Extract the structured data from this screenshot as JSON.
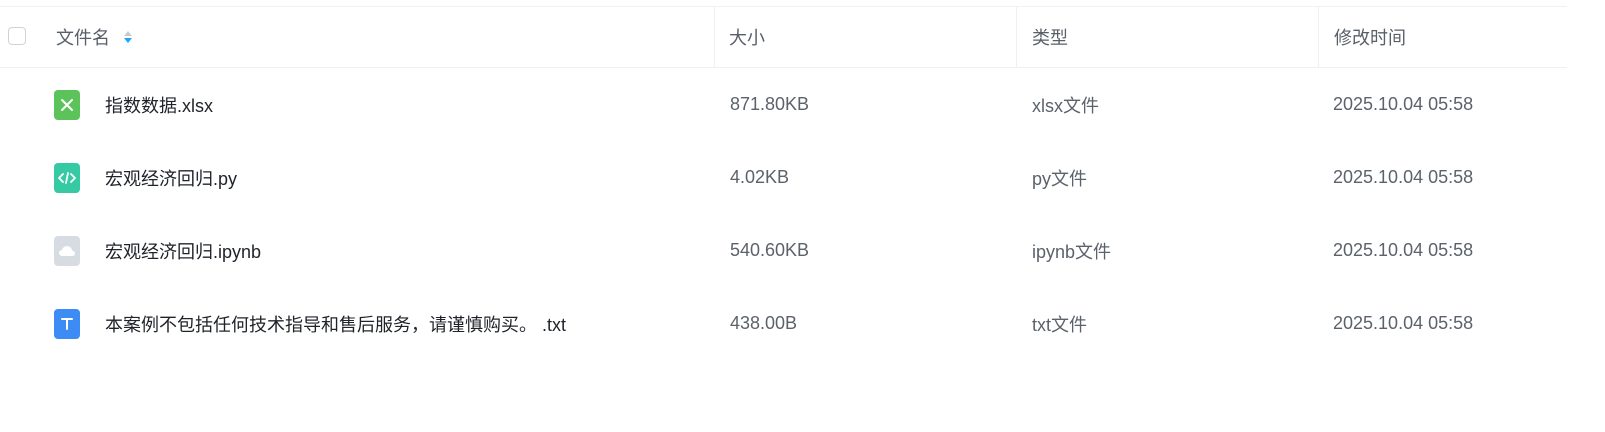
{
  "header": {
    "name_label": "文件名",
    "size_label": "大小",
    "type_label": "类型",
    "modified_label": "修改时间"
  },
  "colors": {
    "xlsx": "#5cc25a",
    "py": "#35c9a4",
    "ipynb": "#d7dbe2",
    "txt": "#3d8bf5",
    "sort_active": "#1aa7f7"
  },
  "files": [
    {
      "name": "指数数据.xlsx",
      "size": "871.80KB",
      "type": "xlsx文件",
      "modified": "2025.10.04 05:58",
      "icon": "excel-file-icon"
    },
    {
      "name": "宏观经济回归.py",
      "size": "4.02KB",
      "type": "py文件",
      "modified": "2025.10.04 05:58",
      "icon": "code-file-icon"
    },
    {
      "name": "宏观经济回归.ipynb",
      "size": "540.60KB",
      "type": "ipynb文件",
      "modified": "2025.10.04 05:58",
      "icon": "cloud-file-icon"
    },
    {
      "name": "本案例不包括任何技术指导和售后服务，请谨慎购买。 .txt",
      "size": "438.00B",
      "type": "txt文件",
      "modified": "2025.10.04 05:58",
      "icon": "text-file-icon"
    }
  ]
}
